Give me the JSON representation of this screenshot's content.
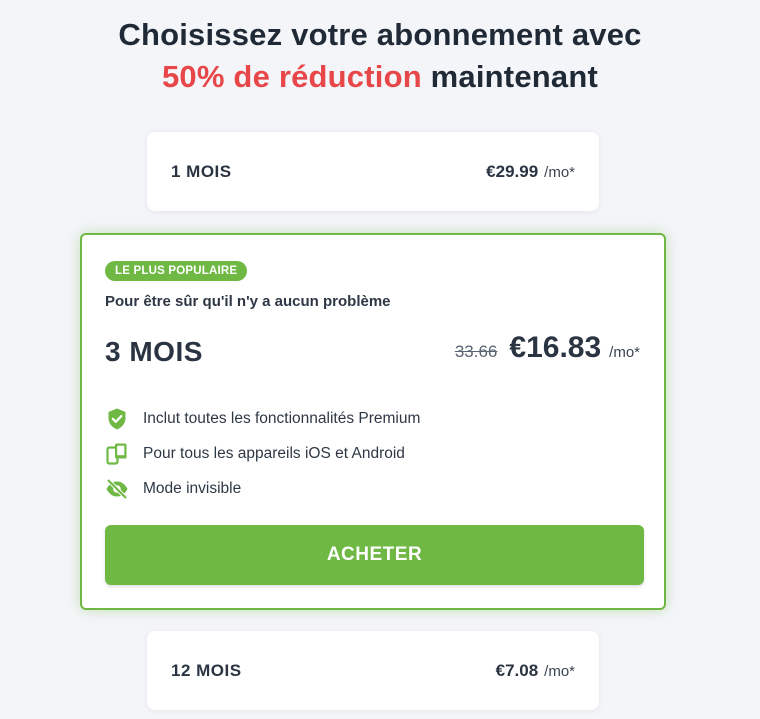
{
  "headline": {
    "line1": "Choisissez votre abonnement avec",
    "accent": "50% de réduction",
    "rest": " maintenant"
  },
  "plans": {
    "one_month": {
      "name": "1 MOIS",
      "price": "€29.99",
      "unit": "/mo*"
    },
    "three_months": {
      "badge": "LE PLUS POPULAIRE",
      "tagline": "Pour être sûr qu'il n'y a aucun problème",
      "name": "3 MOIS",
      "old_price": "33.66",
      "price": "€16.83",
      "unit": "/mo*",
      "features": [
        {
          "icon": "shield-check-icon",
          "text": "Inclut toutes les fonctionnalités Premium"
        },
        {
          "icon": "devices-icon",
          "text": "Pour tous les appareils iOS et Android"
        },
        {
          "icon": "eye-off-icon",
          "text": "Mode invisible"
        }
      ],
      "cta": "ACHETER"
    },
    "twelve_months": {
      "name": "12 MOIS",
      "price": "€7.08",
      "unit": "/mo*"
    }
  },
  "colors": {
    "accent_red": "#e8474a",
    "brand_green": "#6eb843",
    "text_dark": "#2a3442",
    "background": "#f4f5f9"
  }
}
